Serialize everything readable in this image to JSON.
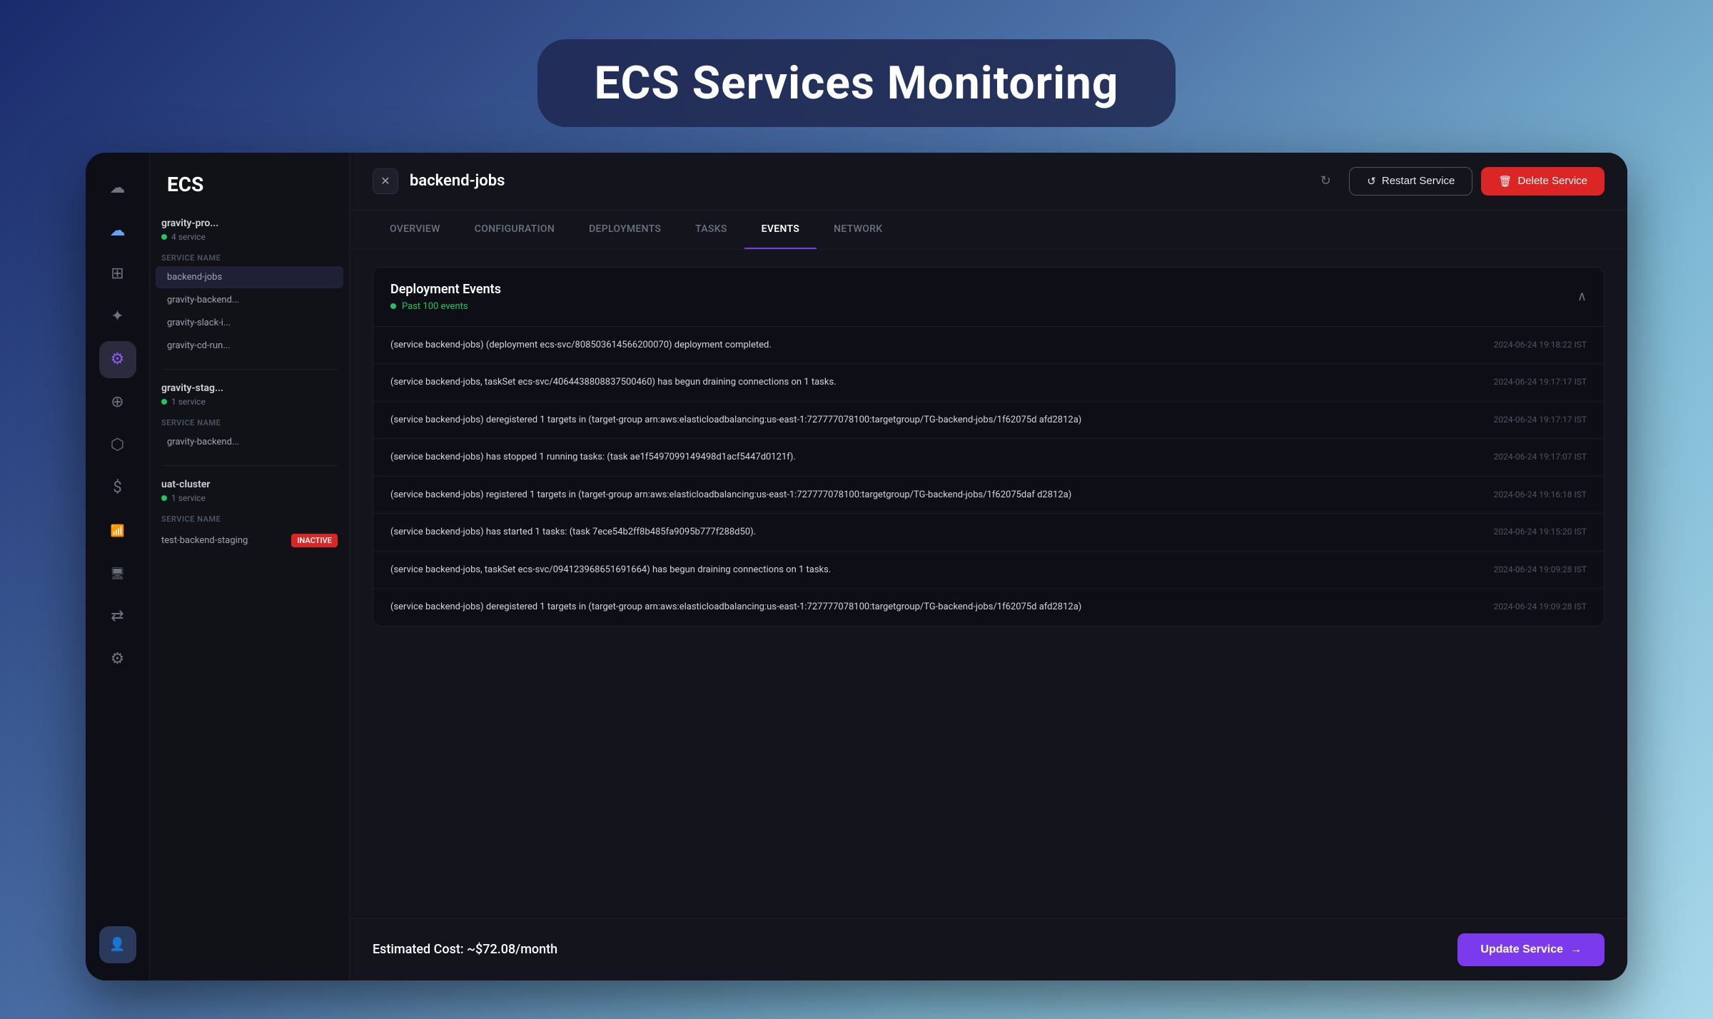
{
  "page": {
    "title": "ECS Services Monitoring"
  },
  "nav": {
    "icons": [
      {
        "name": "cloud-icon",
        "symbol": "☁",
        "active": false
      },
      {
        "name": "cloud2-icon",
        "symbol": "☁",
        "active": false
      },
      {
        "name": "grid-icon",
        "symbol": "⊞",
        "active": false
      },
      {
        "name": "nodes-icon",
        "symbol": "✦",
        "active": false
      },
      {
        "name": "settings-icon",
        "symbol": "⚙",
        "active": true
      },
      {
        "name": "plugin-icon",
        "symbol": "⊕",
        "active": false
      },
      {
        "name": "database-icon",
        "symbol": "⬡",
        "active": false
      },
      {
        "name": "dollar-icon",
        "symbol": "$",
        "active": false
      },
      {
        "name": "signal-icon",
        "symbol": "📶",
        "active": false
      },
      {
        "name": "monitor-icon",
        "symbol": "🖥",
        "active": false
      },
      {
        "name": "transfer-icon",
        "symbol": "⇄",
        "active": false
      },
      {
        "name": "gear-icon",
        "symbol": "⚙",
        "active": false
      },
      {
        "name": "user-icon",
        "symbol": "👤",
        "active": false
      }
    ]
  },
  "sidebar": {
    "title": "ECS",
    "clusters": [
      {
        "name": "gravity-pro",
        "truncated": true,
        "badge": "4 service",
        "services": [
          {
            "name": "backend-jobs",
            "active": true
          },
          {
            "name": "gravity-backend",
            "truncated": true
          },
          {
            "name": "gravity-slack-i",
            "truncated": true
          },
          {
            "name": "gravity-cd-run",
            "truncated": true
          }
        ]
      },
      {
        "name": "gravity-stag",
        "truncated": true,
        "badge": "1 service",
        "services": [
          {
            "name": "gravity-backend",
            "truncated": true
          }
        ]
      },
      {
        "name": "uat-cluster",
        "badge": "1 service",
        "services": [
          {
            "name": "test-backend-staging",
            "status": "INACTIVE"
          }
        ]
      }
    ],
    "service_name_label": "SERVICE NAME"
  },
  "topbar": {
    "service_name": "backend-jobs",
    "restart_label": "Restart Service",
    "delete_label": "Delete Service"
  },
  "tabs": [
    {
      "id": "overview",
      "label": "OVERVIEW",
      "active": false
    },
    {
      "id": "configuration",
      "label": "CONFIGURATION",
      "active": false
    },
    {
      "id": "deployments",
      "label": "DEPLOYMENTS",
      "active": false
    },
    {
      "id": "tasks",
      "label": "TASKS",
      "active": false
    },
    {
      "id": "events",
      "label": "EVENTS",
      "active": true
    },
    {
      "id": "network",
      "label": "NETWORK",
      "active": false
    }
  ],
  "events_section": {
    "title": "Deployment Events",
    "subtitle": "Past 100 events",
    "events": [
      {
        "message": "(service backend-jobs) (deployment ecs-svc/808503614566200070) deployment completed.",
        "timestamp": "2024-06-24 19:18:22 IST"
      },
      {
        "message": "(service backend-jobs, taskSet ecs-svc/4064438808837500460) has begun draining connections on 1 tasks.",
        "timestamp": "2024-06-24 19:17:17 IST"
      },
      {
        "message": "(service backend-jobs) deregistered 1 targets in (target-group arn:aws:elasticloadbalancing:us-east-1:727777078100:targetgroup/TG-backend-jobs/1f62075d afd2812a)",
        "timestamp": "2024-06-24 19:17:17 IST"
      },
      {
        "message": "(service backend-jobs) has stopped 1 running tasks: (task ae1f5497099149498d1acf5447d0121f).",
        "timestamp": "2024-06-24 19:17:07 IST"
      },
      {
        "message": "(service backend-jobs) registered 1 targets in (target-group arn:aws:elasticloadbalancing:us-east-1:727777078100:targetgroup/TG-backend-jobs/1f62075daf d2812a)",
        "timestamp": "2024-06-24 19:16:18 IST"
      },
      {
        "message": "(service backend-jobs) has started 1 tasks: (task 7ece54b2ff8b485fa9095b777f288d50).",
        "timestamp": "2024-06-24 19:15:20 IST"
      },
      {
        "message": "(service backend-jobs, taskSet ecs-svc/094123968651691664) has begun draining connections on 1 tasks.",
        "timestamp": "2024-06-24 19:09:28 IST"
      },
      {
        "message": "(service backend-jobs) deregistered 1 targets in (target-group arn:aws:elasticloadbalancing:us-east-1:727777078100:targetgroup/TG-backend-jobs/1f62075d afd2812a)",
        "timestamp": "2024-06-24 19:09:28 IST"
      }
    ]
  },
  "bottom": {
    "cost_label": "Estimated Cost: ~$72.08/month",
    "update_label": "Update Service"
  }
}
